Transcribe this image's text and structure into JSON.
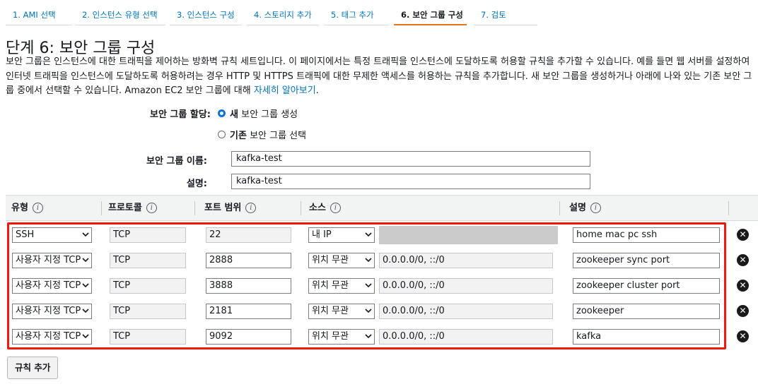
{
  "tabs": [
    {
      "label": "1. AMI 선택"
    },
    {
      "label": "2. 인스턴스 유형 선택"
    },
    {
      "label": "3. 인스턴스 구성"
    },
    {
      "label": "4. 스토리지 추가"
    },
    {
      "label": "5. 태그 추가"
    },
    {
      "label": "6. 보안 그룹 구성"
    },
    {
      "label": "7. 검토"
    }
  ],
  "active_tab": 5,
  "page": {
    "title": "단계 6: 보안 그룹 구성",
    "description": "보안 그룹은 인스턴스에 대한 트래픽을 제어하는 방화벽 규칙 세트입니다. 이 페이지에서는 특정 트래픽을 인스턴스에 도달하도록 허용할 규칙을 추가할 수 있습니다. 예를 들면 웹 서버를 설정하여 인터넷 트래픽을 인스턴스에 도달하도록 허용하려는 경우 HTTP 및 HTTPS 트래픽에 대한 무제한 액세스를 허용하는 규칙을 추가합니다. 새 보안 그룹을 생성하거나 아래에 나와 있는 기존 보안 그룹 중에서 선택할 수 있습니다. Amazon EC2 보안 그룹에 대해",
    "learn_more": "자세히 알아보기",
    "period": "."
  },
  "form": {
    "assign_label": "보안 그룹 할당:",
    "option_new_bold": "새",
    "option_new_rest": "보안 그룹 생성",
    "option_existing_bold": "기존",
    "option_existing_rest": "보안 그룹 선택",
    "selected_option": "new",
    "name_label": "보안 그룹 이름:",
    "name_value": "kafka-test",
    "desc_label": "설명:",
    "desc_value": "kafka-test"
  },
  "table": {
    "headers": {
      "type": "유형",
      "protocol": "프로토콜",
      "port": "포트 범위",
      "source": "소스",
      "description": "설명"
    },
    "info_glyph": "i",
    "rows": [
      {
        "type": "SSH",
        "protocol": "TCP",
        "port": "22",
        "port_editable": false,
        "source": "내 IP",
        "cidr": "",
        "cidr_masked": true,
        "description": "home mac pc ssh"
      },
      {
        "type": "사용자 지정 TCP",
        "protocol": "TCP",
        "port": "2888",
        "port_editable": true,
        "source": "위치 무관",
        "cidr": "0.0.0.0/0, ::/0",
        "cidr_masked": false,
        "description": "zookeeper sync port"
      },
      {
        "type": "사용자 지정 TCP",
        "protocol": "TCP",
        "port": "3888",
        "port_editable": true,
        "source": "위치 무관",
        "cidr": "0.0.0.0/0, ::/0",
        "cidr_masked": false,
        "description": "zookeeper cluster port"
      },
      {
        "type": "사용자 지정 TCP",
        "protocol": "TCP",
        "port": "2181",
        "port_editable": true,
        "source": "위치 무관",
        "cidr": "0.0.0.0/0, ::/0",
        "cidr_masked": false,
        "description": "zookeeper"
      },
      {
        "type": "사용자 지정 TCP",
        "protocol": "TCP",
        "port": "9092",
        "port_editable": true,
        "source": "위치 무관",
        "cidr": "0.0.0.0/0, ::/0",
        "cidr_masked": false,
        "description": "kafka"
      }
    ]
  },
  "add_rule_label": "규칙 추가",
  "delete_glyph": "✕",
  "colors": {
    "link": "#0073bb",
    "active_tab_underline": "#ec7211",
    "highlight_border": "#f0180a",
    "radio_selected": "#0972d3"
  }
}
